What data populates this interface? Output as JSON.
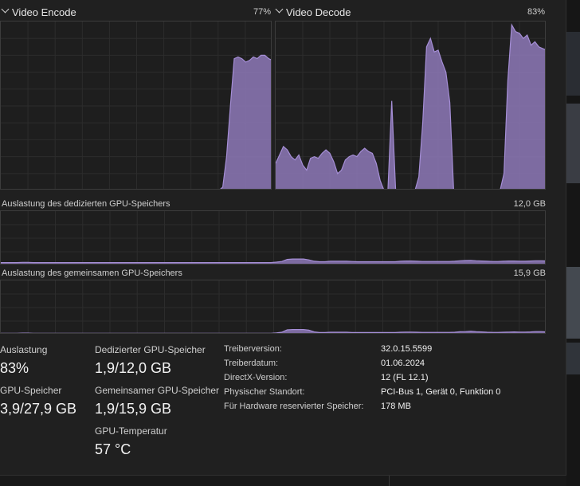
{
  "encode": {
    "title": "Video Encode",
    "percent": "77%"
  },
  "decode": {
    "title": "Video Decode",
    "percent": "83%"
  },
  "dedicated": {
    "title": "Auslastung des dedizierten GPU-Speichers",
    "max": "12,0 GB"
  },
  "shared": {
    "title": "Auslastung des gemeinsamen GPU-Speichers",
    "max": "15,9 GB"
  },
  "stats": {
    "utilization": {
      "label": "Auslastung",
      "value": "83%"
    },
    "gpu_memory": {
      "label": "GPU-Speicher",
      "value": "3,9/27,9 GB"
    },
    "dedicated_memory": {
      "label": "Dedizierter GPU-Speicher",
      "value": "1,9/12,0 GB"
    },
    "shared_memory": {
      "label": "Gemeinsamer GPU-Speicher",
      "value": "1,9/15,9 GB"
    },
    "temperature": {
      "label": "GPU-Temperatur",
      "value": "57 °C"
    }
  },
  "properties": [
    {
      "label": "Treiberversion:",
      "value": "32.0.15.5599"
    },
    {
      "label": "Treiberdatum:",
      "value": "01.06.2024"
    },
    {
      "label": "DirectX-Version:",
      "value": "12 (FL 12.1)"
    },
    {
      "label": "Physischer Standort:",
      "value": "PCI-Bus 1, Gerät 0, Funktion 0"
    },
    {
      "label": "Für Hardware reservierter Speicher:",
      "value": "178 MB"
    }
  ],
  "colors": {
    "accent_fill": "#8e79b8",
    "accent_line": "#a58ed6",
    "grid": "#2c2c2c",
    "border": "#3c3c3c"
  },
  "chart_data": [
    {
      "type": "area",
      "title": "Video Encode",
      "ylim": [
        0,
        100
      ],
      "values": [
        0,
        0,
        0,
        0,
        0,
        0,
        0,
        0,
        0,
        0,
        0,
        0,
        0,
        0,
        0,
        0,
        0,
        0,
        0,
        0,
        0,
        0,
        0,
        0,
        0,
        0,
        0,
        0,
        0,
        0,
        0,
        0,
        0,
        0,
        0,
        0,
        0,
        0,
        0,
        0,
        0,
        0,
        0,
        0,
        0,
        0,
        0,
        0,
        0,
        0,
        0,
        0,
        0,
        0,
        0,
        0,
        0,
        0,
        2,
        20,
        50,
        78,
        79,
        78,
        76,
        77,
        79,
        78,
        80,
        80,
        78,
        77
      ]
    },
    {
      "type": "area",
      "title": "Video Decode",
      "ylim": [
        0,
        100
      ],
      "values": [
        16,
        21,
        26,
        24,
        20,
        18,
        21,
        15,
        12,
        19,
        20,
        19,
        22,
        24,
        22,
        17,
        10,
        12,
        18,
        20,
        21,
        20,
        23,
        25,
        23,
        22,
        16,
        6,
        0,
        0,
        53,
        0,
        0,
        0,
        0,
        0,
        0,
        8,
        40,
        85,
        90,
        82,
        83,
        76,
        70,
        52,
        0,
        0,
        0,
        0,
        0,
        0,
        0,
        0,
        0,
        0,
        0,
        0,
        0,
        10,
        65,
        98,
        94,
        93,
        90,
        92,
        86,
        88,
        85,
        84,
        83
      ]
    },
    {
      "type": "area",
      "title": "Auslastung des dedizierten GPU-Speichers",
      "ylim": [
        0,
        12.0
      ],
      "values": [
        0.6,
        0.6,
        0.6,
        0.6,
        0.65,
        0.65,
        0.6,
        0.6,
        0.6,
        0.6,
        0.6,
        0.6,
        0.6,
        0.6,
        0.6,
        0.6,
        0.6,
        0.6,
        0.6,
        0.6,
        0.6,
        0.6,
        0.6,
        0.6,
        0.6,
        0.6,
        0.6,
        0.6,
        0.6,
        0.6,
        0.6,
        0.6,
        0.6,
        0.6,
        0.6,
        0.6,
        0.6,
        0.6,
        0.6,
        0.6,
        0.6,
        0.6,
        0.6,
        0.6,
        0.6,
        0.6,
        0.6,
        0.6,
        0.6,
        0.6,
        0.6,
        0.7,
        0.85,
        1.3,
        1.4,
        1.4,
        1.4,
        1.2,
        0.9,
        0.8,
        0.8,
        0.9,
        0.9,
        0.9,
        0.9,
        0.85,
        0.8,
        0.8,
        0.8,
        0.8,
        0.8,
        0.8,
        0.8,
        0.8,
        0.9,
        0.95,
        0.95,
        0.9,
        0.85,
        0.85,
        0.85,
        0.85,
        0.85,
        0.85,
        0.9,
        1.0,
        1.05,
        1.1,
        1.0,
        0.95,
        0.9,
        0.85,
        0.85,
        0.9,
        0.95,
        0.95,
        0.9,
        0.9,
        0.95,
        1.0,
        1.0,
        0.95
      ]
    },
    {
      "type": "area",
      "title": "Auslastung des gemeinsamen GPU-Speichers",
      "ylim": [
        0,
        15.9
      ],
      "values": [
        0.4,
        0.4,
        0.4,
        0.4,
        0.45,
        0.45,
        0.4,
        0.4,
        0.4,
        0.4,
        0.4,
        0.4,
        0.4,
        0.4,
        0.4,
        0.4,
        0.4,
        0.4,
        0.4,
        0.4,
        0.4,
        0.4,
        0.4,
        0.4,
        0.4,
        0.4,
        0.4,
        0.4,
        0.4,
        0.4,
        0.4,
        0.4,
        0.4,
        0.4,
        0.4,
        0.4,
        0.4,
        0.4,
        0.4,
        0.4,
        0.4,
        0.4,
        0.4,
        0.4,
        0.4,
        0.4,
        0.4,
        0.4,
        0.4,
        0.4,
        0.4,
        0.5,
        0.7,
        1.4,
        1.5,
        1.5,
        1.5,
        1.3,
        0.8,
        0.6,
        0.6,
        0.7,
        0.7,
        0.7,
        0.7,
        0.6,
        0.6,
        0.6,
        0.6,
        0.6,
        0.6,
        0.6,
        0.6,
        0.6,
        0.7,
        0.75,
        0.75,
        0.7,
        0.65,
        0.65,
        0.65,
        0.65,
        0.65,
        0.65,
        0.7,
        0.85,
        0.9,
        1.0,
        0.85,
        0.8,
        0.7,
        0.65,
        0.65,
        0.7,
        0.75,
        0.8,
        0.75,
        0.75,
        0.8,
        0.9,
        0.9,
        0.8
      ]
    }
  ]
}
